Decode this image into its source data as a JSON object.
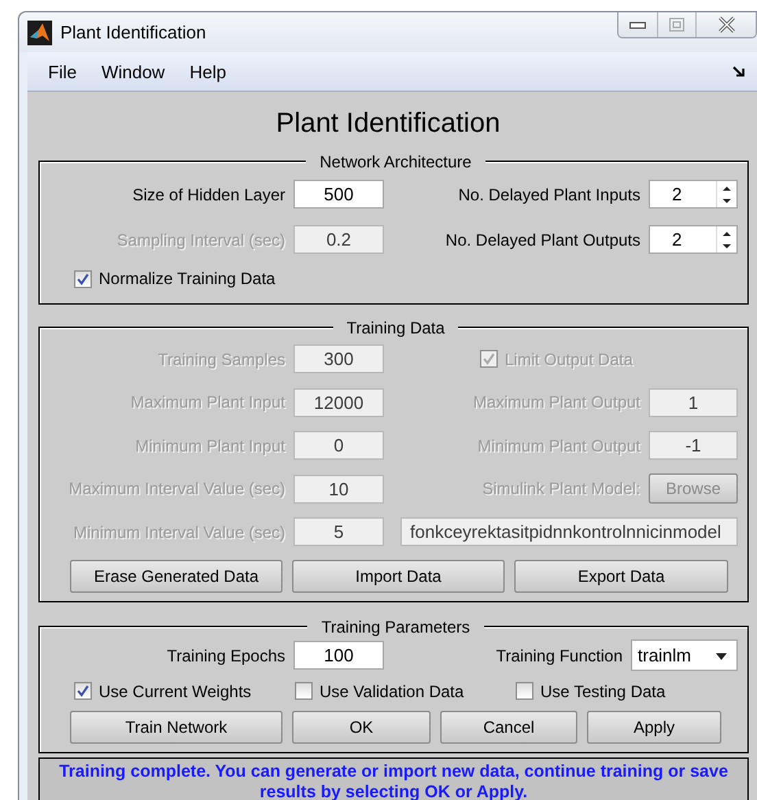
{
  "window": {
    "title": "Plant Identification"
  },
  "menu": [
    {
      "label": "File"
    },
    {
      "label": "Window"
    },
    {
      "label": "Help"
    }
  ],
  "heading": "Plant Identification",
  "network_architecture": {
    "title": "Network Architecture",
    "rows": [
      {
        "left": {
          "kind": "field",
          "label": "Size of Hidden Layer",
          "value": "500",
          "disabled": false
        },
        "right": {
          "kind": "spinner",
          "label": "No. Delayed Plant Inputs",
          "value": "2",
          "disabled": false
        }
      },
      {
        "left": {
          "kind": "field",
          "label": "Sampling Interval (sec)",
          "value": "0.2",
          "disabled": true
        },
        "right": {
          "kind": "spinner",
          "label": "No. Delayed Plant Outputs",
          "value": "2",
          "disabled": false
        }
      }
    ],
    "checkboxes": [
      {
        "label": "Normalize Training Data",
        "checked": true,
        "disabled": false
      }
    ]
  },
  "training_data": {
    "title": "Training Data",
    "rows": [
      {
        "left": {
          "kind": "field",
          "label": "Training Samples",
          "value": "300",
          "disabled": true
        },
        "right": {
          "kind": "checkbox",
          "label": "Limit Output Data",
          "checked": true,
          "disabled": true
        }
      },
      {
        "left": {
          "kind": "field",
          "label": "Maximum Plant Input",
          "value": "12000",
          "disabled": true
        },
        "right": {
          "kind": "field",
          "label": "Maximum Plant Output",
          "value": "1",
          "disabled": true
        }
      },
      {
        "left": {
          "kind": "field",
          "label": "Minimum Plant Input",
          "value": "0",
          "disabled": true
        },
        "right": {
          "kind": "field",
          "label": "Minimum Plant Output",
          "value": "-1",
          "disabled": true
        }
      },
      {
        "left": {
          "kind": "field",
          "label": "Maximum Interval Value (sec)",
          "value": "10",
          "disabled": true
        },
        "right": {
          "kind": "browse",
          "label": "Simulink Plant Model:",
          "button": "Browse",
          "disabled": true
        }
      },
      {
        "left": {
          "kind": "field",
          "label": "Minimum Interval Value (sec)",
          "value": "5",
          "disabled": true
        },
        "right": {
          "kind": "wide",
          "value": "fonkceyrektasitpidnnkontrolnnicinmodel",
          "disabled": true
        }
      }
    ],
    "buttons": [
      {
        "label": "Erase Generated Data"
      },
      {
        "label": "Import Data"
      },
      {
        "label": "Export Data"
      }
    ]
  },
  "training_parameters": {
    "title": "Training Parameters",
    "rows": [
      {
        "left": {
          "kind": "field",
          "label": "Training Epochs",
          "value": "100",
          "disabled": false
        },
        "right": {
          "kind": "dropdown",
          "label": "Training Function",
          "value": "trainlm",
          "disabled": false
        }
      }
    ],
    "checkboxes": [
      {
        "label": "Use Current Weights",
        "checked": true,
        "disabled": false
      },
      {
        "label": "Use Validation Data",
        "checked": false,
        "disabled": false
      },
      {
        "label": "Use Testing Data",
        "checked": false,
        "disabled": false
      }
    ],
    "buttons": [
      {
        "label": "Train Network"
      },
      {
        "label": "OK"
      },
      {
        "label": "Cancel"
      },
      {
        "label": "Apply"
      }
    ]
  },
  "status_message": "Training complete. You can generate or import new data, continue training or save results by selecting OK or Apply."
}
